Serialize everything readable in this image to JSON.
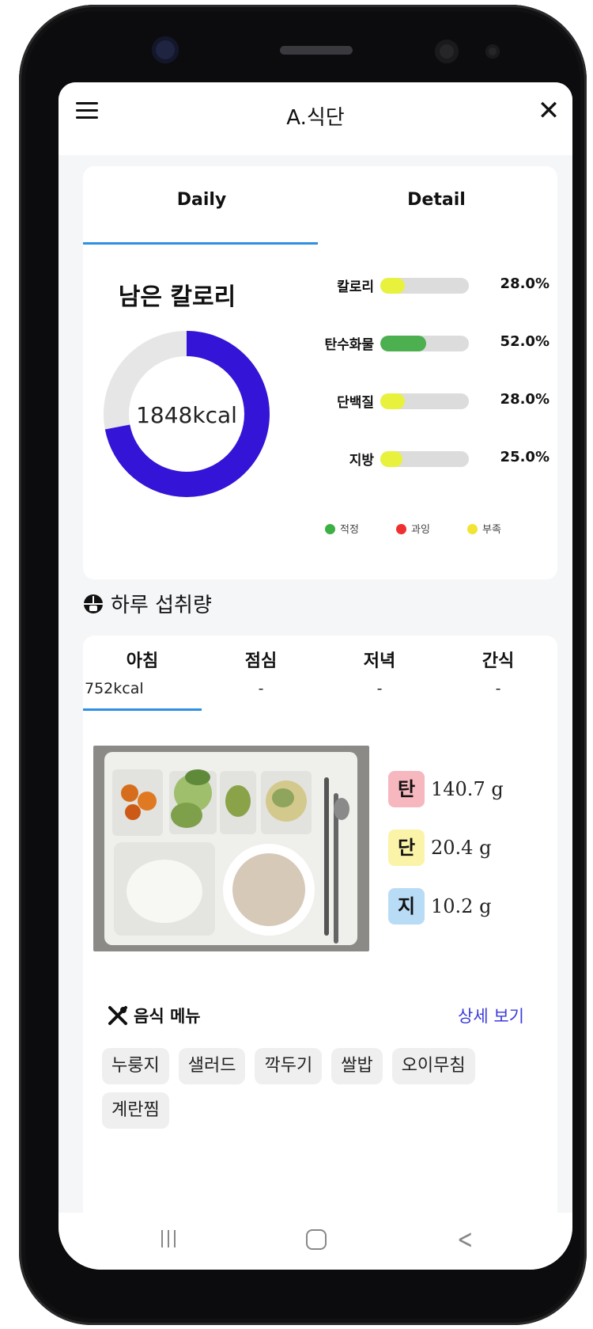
{
  "app": {
    "title": "A.식단"
  },
  "tabs": [
    {
      "label": "Daily",
      "active": true
    },
    {
      "label": "Detail",
      "active": false
    }
  ],
  "summary": {
    "title": "남은 칼로리",
    "remaining_label": "1848kcal",
    "donut_fraction": 0.72,
    "donut_color": "#3414d6",
    "donut_track_color": "#e6e6e6",
    "nutrients": [
      {
        "name": "칼로리",
        "percent_label": "28.0%",
        "value": 0.28,
        "color": "#e8f23c"
      },
      {
        "name": "탄수화물",
        "percent_label": "52.0%",
        "value": 0.52,
        "color": "#4caf50"
      },
      {
        "name": "단백질",
        "percent_label": "28.0%",
        "value": 0.28,
        "color": "#e8f23c"
      },
      {
        "name": "지방",
        "percent_label": "25.0%",
        "value": 0.25,
        "color": "#e8f23c"
      }
    ],
    "legend": [
      {
        "label": "적정",
        "color": "#3cb043"
      },
      {
        "label": "과잉",
        "color": "#ee3030"
      },
      {
        "label": "부족",
        "color": "#f2e433"
      }
    ]
  },
  "intake": {
    "title": "하루 섭취량",
    "meals": [
      {
        "name": "아침",
        "kcal": "752kcal",
        "active": true
      },
      {
        "name": "점심",
        "kcal": "-",
        "active": false
      },
      {
        "name": "저녁",
        "kcal": "-",
        "active": false
      },
      {
        "name": "간식",
        "kcal": "-",
        "active": false
      }
    ],
    "macros": [
      {
        "badge": "탄",
        "value": "140.7 g",
        "color": "#f6b7bf"
      },
      {
        "badge": "단",
        "value": "20.4 g",
        "color": "#fbf3a8"
      },
      {
        "badge": "지",
        "value": "10.2 g",
        "color": "#b9dcf6"
      }
    ],
    "menu_title": "음식 메뉴",
    "detail_link": "상세 보기",
    "foods": [
      "누룽지",
      "샐러드",
      "깍두기",
      "쌀밥",
      "오이무침",
      "계란찜"
    ]
  },
  "icons": {
    "menu": "hamburger-menu-icon",
    "close": "close-icon",
    "intake": "bowl-icon",
    "menu_head": "fork-knife-icon"
  }
}
